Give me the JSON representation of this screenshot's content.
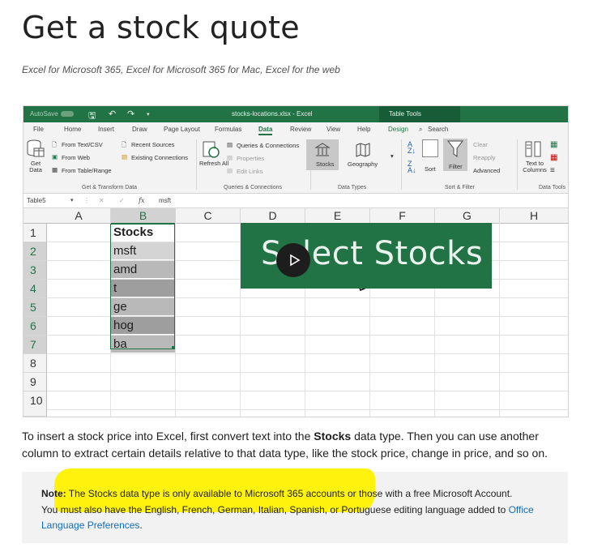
{
  "page": {
    "title": "Get a stock quote",
    "applies_to": "Excel for Microsoft 365, Excel for Microsoft 365 for Mac, Excel for the web"
  },
  "excel": {
    "titlebar": {
      "autosave": "AutoSave",
      "filename": "stocks-locations.xlsx - Excel",
      "table_tools": "Table Tools"
    },
    "tabs": [
      "File",
      "Home",
      "Insert",
      "Draw",
      "Page Layout",
      "Formulas",
      "Data",
      "Review",
      "View",
      "Help",
      "Design",
      "Search"
    ],
    "active_tab": "Data",
    "ribbon": {
      "get_data": "Get\nData",
      "from_text_csv": "From Text/CSV",
      "from_web": "From Web",
      "from_table_range": "From Table/Range",
      "recent_sources": "Recent Sources",
      "existing_connections": "Existing Connections",
      "group_get_transform": "Get & Transform Data",
      "refresh_all": "Refresh All",
      "queries_connections": "Queries & Connections",
      "properties": "Properties",
      "edit_links": "Edit Links",
      "group_queries": "Queries & Connections",
      "stocks": "Stocks",
      "geography": "Geography",
      "group_data_types": "Data Types",
      "sort": "Sort",
      "filter": "Filter",
      "clear": "Clear",
      "reapply": "Reapply",
      "advanced": "Advanced",
      "group_sort_filter": "Sort & Filter",
      "text_to_columns": "Text to Columns",
      "group_data_tools": "Data Tools"
    },
    "formula_bar": {
      "name_box": "Table5",
      "fx": "fx",
      "value": "msft"
    },
    "columns": [
      "A",
      "B",
      "C",
      "D",
      "E",
      "F",
      "G",
      "H"
    ],
    "rows": [
      "1",
      "2",
      "3",
      "4",
      "5",
      "6",
      "7",
      "8",
      "9",
      "10"
    ],
    "table_header": "Stocks",
    "table_values": [
      "msft",
      "amd",
      "t",
      "ge",
      "hog",
      "ba"
    ],
    "overlay_text": "Select Stocks"
  },
  "body": {
    "para_before": "To insert a stock price into Excel, first convert text into the ",
    "para_bold": "Stocks",
    "para_after": " data type. Then you can use another column to extract certain details relative to that data type, like the stock price, change in price, and so on."
  },
  "note": {
    "label": "Note:",
    "line1": " The Stocks data type is only available to Microsoft 365 accounts or those with a free Microsoft Account.",
    "line2": "You must also have the English, French, German, Italian, Spanish, or Portuguese editing language added to ",
    "link": "Office Language Preferences",
    "end": "."
  },
  "colors": {
    "excel_green": "#217346",
    "highlight": "#fff200",
    "link": "#0f6cbd"
  }
}
